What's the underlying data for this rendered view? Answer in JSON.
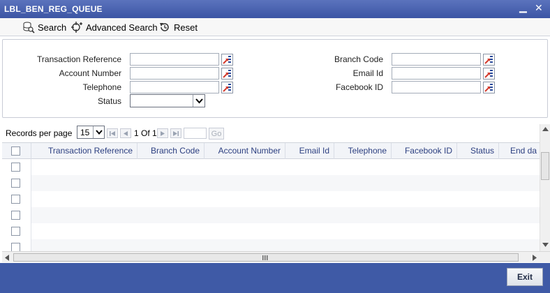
{
  "window": {
    "title": "LBL_BEN_REG_QUEUE",
    "minimize": "▁",
    "close": "✕"
  },
  "toolbar": {
    "search_label": "Search",
    "advanced_search_label": "Advanced Search",
    "reset_label": "Reset"
  },
  "form": {
    "transaction_reference_label": "Transaction Reference",
    "account_number_label": "Account Number",
    "telephone_label": "Telephone",
    "status_label": "Status",
    "branch_code_label": "Branch Code",
    "email_id_label": "Email Id",
    "facebook_id_label": "Facebook ID",
    "transaction_reference_value": "",
    "account_number_value": "",
    "telephone_value": "",
    "status_value": "",
    "branch_code_value": "",
    "email_id_value": "",
    "facebook_id_value": ""
  },
  "pager": {
    "records_per_page_label": "Records per page",
    "records_per_page_value": "15",
    "page_info": "1 Of 1",
    "go_label": "Go"
  },
  "grid": {
    "columns": [
      "Transaction Reference",
      "Branch Code",
      "Account Number",
      "Email Id",
      "Telephone",
      "Facebook ID",
      "Status",
      "End da"
    ]
  },
  "footer": {
    "exit_label": "Exit"
  },
  "colors": {
    "title_bar": "#4a63b2",
    "footer": "#3f5aa6",
    "header_text": "#2c3f80",
    "lov_icon_red": "#d33a2c",
    "lov_icon_blue": "#2a4a9a"
  }
}
